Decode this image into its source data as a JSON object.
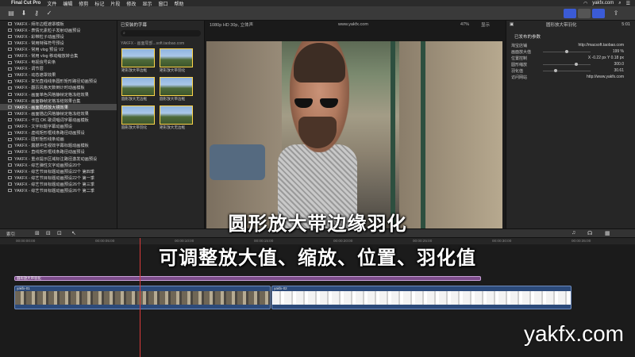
{
  "menubar": {
    "app": "Final Cut Pro",
    "items": [
      "文件",
      "编辑",
      "修剪",
      "标记",
      "片段",
      "修改",
      "显示",
      "窗口",
      "帮助"
    ],
    "right": "yakfx.com"
  },
  "library": {
    "items": [
      "YAKFX - 拜年边框遮罩模板",
      "YAKFX - 表情元素粒子发射动画预设",
      "YAKFX - 彩带粒子动画预设",
      "YAKFX - 常用特殊符号预设",
      "YAKFX - 常用 vlog 预设 V2",
      "YAKFX - 常用 vlog 移动缩放转合集",
      "YAKFX - 电视信号彩条",
      "YAKFX - 调节层",
      "YAKFX - 动态遮罩效果",
      "YAKFX - 复光直线线条圆形矩形路径动画预设",
      "YAKFX - 翻页风格天数倒计时动画模板",
      "YAKFX - 画面单色风格静帧定格冻结效果",
      "YAKFX - 画面静帧定格冻结效果合集",
      "YAKFX - 画面局部放大镜效果",
      "YAKFX - 画面描边风格静帧定格冻结效果",
      "YAKFX - 卡拉 OK 歌词唱词字幕动画模板",
      "YAKFX - 文字标题字幕动画预设",
      "YAKFX - 虚线矩形框线条路径动画预设",
      "YAKFX - 圆形矩形线条动画",
      "YAKFX - 震撼冲击视效字幕标题动画模板",
      "YAKFX - 直线矩形框线条路径动画预设",
      "YAKFX - 重点提示区域标注路径激发动画预设",
      "YAKFX - 综艺弹性文字动画预设20个",
      "YAKFX - 综艺节目标题动画预设22个 第四季",
      "YAKFX - 综艺节目标题动画预设22个 第一季",
      "YAKFX - 综艺节目标题动画预设26个 第三季",
      "YAKFX - 综艺节目标题动画预设26个 第二季"
    ],
    "selected_index": 13
  },
  "browser": {
    "header": "已安装的字幕",
    "group_label": "YAKFX - 画面局部...soft.taobao.com",
    "thumbnails": [
      "矩形放大带边框",
      "矩形放大带羽化",
      "圆形放大无边框",
      "圆形放大带边框",
      "圆形放大带羽化",
      "矩形放大无边框"
    ]
  },
  "viewer": {
    "format": "1080p HD 30p, 立体声",
    "url": "www.yakfx.com",
    "zoom": "47%",
    "display": "显示"
  },
  "inspector": {
    "clip_name": "圆形放大带羽化",
    "duration": "5:01",
    "section": "已发布的参数",
    "params": [
      {
        "label": "淘宝店铺",
        "value": "http://macsoft.taobao.com"
      },
      {
        "label": "画面放大值",
        "value": "199 %"
      },
      {
        "label": "位置控制",
        "value": "X -0.22 px   Y 0.18 px"
      },
      {
        "label": "圆形缩放",
        "value": "300.0"
      },
      {
        "label": "羽化值",
        "value": "30.61"
      },
      {
        "label": "访问网站",
        "value": "http://www.yakfx.com"
      }
    ]
  },
  "timeline": {
    "index_label": "索引",
    "ruler": [
      "00:00:00:00",
      "00:00:05:00",
      "00:00:10:00",
      "00:00:15:00",
      "00:00:20:00",
      "00:00:25:00",
      "00:00:30:00",
      "00:00:35:00"
    ],
    "title_clip": "圆形放大带羽化",
    "clips": [
      "yakfx-01",
      "yakfx-02"
    ]
  },
  "captions": {
    "line1": "圆形放大带边缘羽化",
    "line2": "可调整放大值、缩放、位置、羽化值"
  },
  "watermark": "yakfx.com"
}
